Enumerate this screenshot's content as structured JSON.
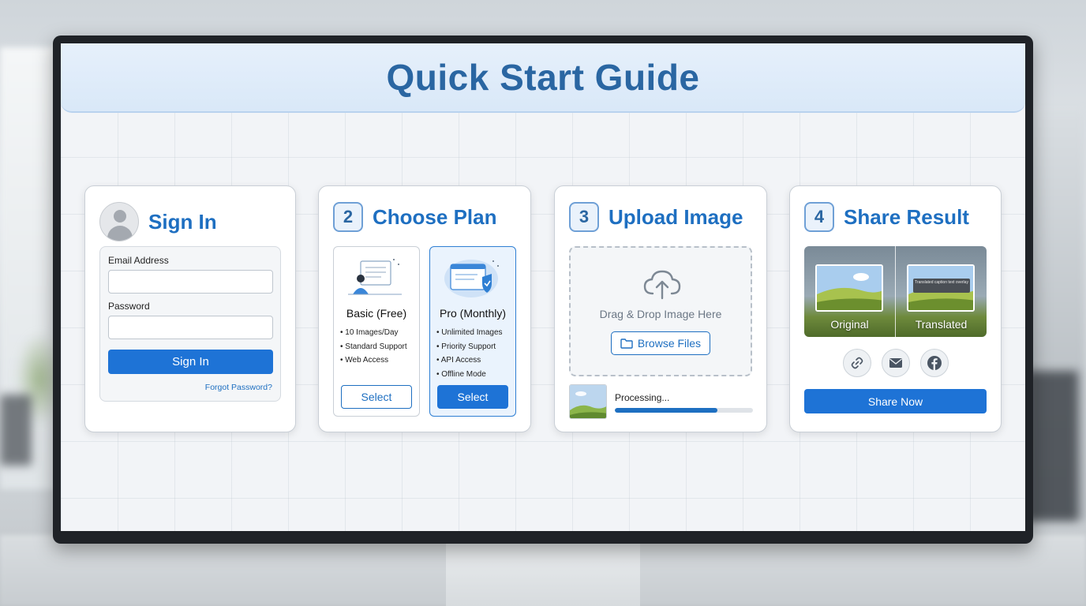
{
  "header": {
    "title": "Quick Start Guide"
  },
  "steps": {
    "signin": {
      "title": "Sign In",
      "email_label": "Email Address",
      "email_value": "",
      "password_label": "Password",
      "password_value": "",
      "button_label": "Sign In",
      "forgot_label": "Forgot Password?"
    },
    "plan": {
      "number": "2",
      "title": "Choose Plan",
      "plans": [
        {
          "name": "Basic (Free)",
          "features": [
            "10 Images/Day",
            "Standard Support",
            "Web Access"
          ],
          "button": "Select",
          "selected": false
        },
        {
          "name": "Pro (Monthly)",
          "features": [
            "Unlimited Images",
            "Priority Support",
            "API Access",
            "Offline Mode"
          ],
          "button": "Select",
          "selected": true
        }
      ]
    },
    "upload": {
      "number": "3",
      "title": "Upload Image",
      "drop_text": "Drag & Drop Image Here",
      "browse_label": "Browse Files",
      "status": "Processing...",
      "progress_percent": 74
    },
    "share": {
      "number": "4",
      "title": "Share Result",
      "original_label": "Original",
      "translated_label": "Translated",
      "translated_caption": "Translated caption text overlay",
      "share_icons": [
        "link-icon",
        "mail-icon",
        "facebook-icon"
      ],
      "share_button": "Share Now"
    }
  },
  "colors": {
    "accent": "#1e73d6",
    "title": "#2a66a2",
    "header_bg": "#dbe9f8"
  }
}
